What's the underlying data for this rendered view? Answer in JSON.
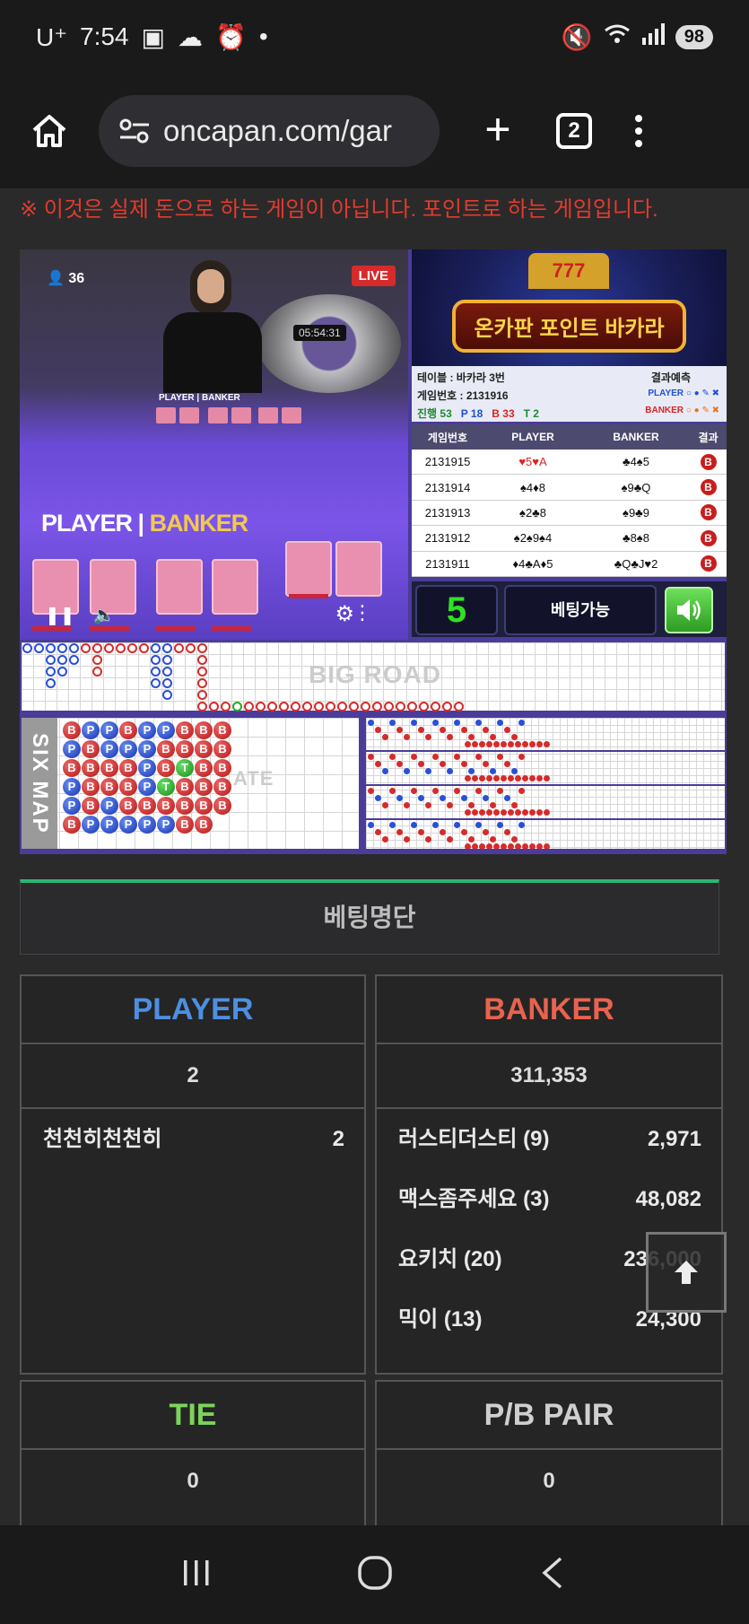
{
  "status_bar": {
    "carrier": "U⁺",
    "time": "7:54",
    "battery": "98"
  },
  "browser": {
    "url": "oncapan.com/gar",
    "tab_count": "2"
  },
  "notice": "※ 이것은 실제 돈으로 하는 게임이 아닙니다. 포인트로 하는 게임입니다.",
  "video": {
    "viewers": "36",
    "live": "LIVE",
    "clock": "05:54:31",
    "small_label": "PLAYER | BANKER",
    "player_label": "PLAYER",
    "banker_label": "BANKER"
  },
  "logo": {
    "title": "온카판 포인트 바카라",
    "slot": "777"
  },
  "info": {
    "table": "테이블 : 바카라 3번",
    "game_no": "게임번호 : 2131916",
    "progress": "진행 53",
    "player_count": "P 18",
    "banker_count": "B 33",
    "tie_count": "T 2",
    "prediction_title": "결과예측",
    "pred_player": "PLAYER",
    "pred_banker": "BANKER"
  },
  "results": {
    "headers": [
      "게임번호",
      "PLAYER",
      "BANKER",
      "결과"
    ],
    "rows": [
      {
        "no": "2131915",
        "player": "♥5♥A",
        "banker": "♣4♠5",
        "result": "B"
      },
      {
        "no": "2131914",
        "player": "♠4♦8",
        "banker": "♠9♣Q",
        "result": "B"
      },
      {
        "no": "2131913",
        "player": "♠2♣8",
        "banker": "♠9♣9",
        "result": "B"
      },
      {
        "no": "2131912",
        "player": "♠2♠9♠4",
        "banker": "♣8♠8",
        "result": "B"
      },
      {
        "no": "2131911",
        "player": "♦4♣A♦5",
        "banker": "♣Q♣J♥2",
        "result": "B"
      }
    ]
  },
  "bet_bar": {
    "count": "5",
    "status": "베팅가능"
  },
  "roads": {
    "big_road": "BIG ROAD",
    "six_map": "SIX MAP",
    "faint": "ATE"
  },
  "sixmap_grid": [
    [
      "B",
      "P",
      "P",
      "B",
      "P",
      "P",
      "B",
      "B",
      "B"
    ],
    [
      "P",
      "B",
      "P",
      "P",
      "P",
      "B",
      "B",
      "B",
      "B"
    ],
    [
      "B",
      "B",
      "B",
      "B",
      "P",
      "B",
      "T",
      "B",
      "B"
    ],
    [
      "P",
      "B",
      "B",
      "B",
      "P",
      "T",
      "B",
      "B",
      "B"
    ],
    [
      "P",
      "B",
      "P",
      "B",
      "B",
      "B",
      "B",
      "B",
      "B"
    ],
    [
      "B",
      "P",
      "P",
      "P",
      "P",
      "P",
      "B",
      "B",
      ""
    ]
  ],
  "betting_list": {
    "title": "베팅명단",
    "player": {
      "label": "PLAYER",
      "total": "2",
      "entries": [
        {
          "name": "천천히천천히",
          "amount": "2"
        }
      ]
    },
    "banker": {
      "label": "BANKER",
      "total": "311,353",
      "entries": [
        {
          "name": "러스티더스티 (9)",
          "amount": "2,971"
        },
        {
          "name": "맥스좀주세요 (3)",
          "amount": "48,082"
        },
        {
          "name": "요키치 (20)",
          "amount": "236,000"
        },
        {
          "name": "믹이 (13)",
          "amount": "24,300"
        }
      ]
    },
    "tie": {
      "label": "TIE",
      "total": "0"
    },
    "pair": {
      "label": "P/B PAIR",
      "total": "0"
    }
  },
  "colors": {
    "player": "#4d8fe0",
    "banker": "#e8634f",
    "tie": "#7cd35b",
    "pair": "#cfcfcf",
    "accent_green": "#2bb673"
  }
}
